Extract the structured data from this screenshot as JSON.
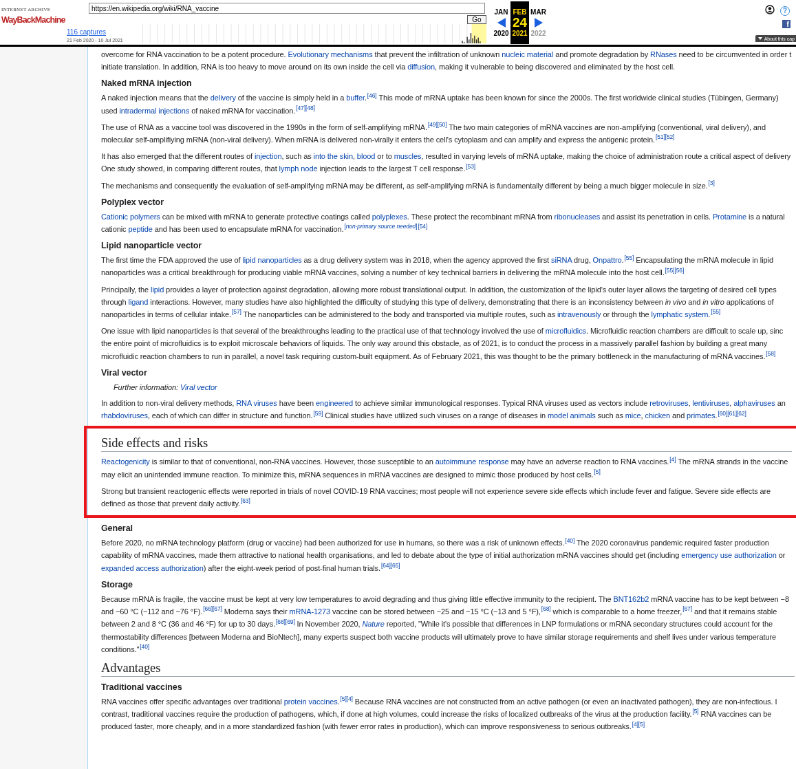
{
  "toolbar": {
    "logo_top": "INTERNET ARCHIVE",
    "logo": "WayBackMachine",
    "url": "https://en.wikipedia.org/wiki/RNA_vaccine",
    "go": "Go",
    "captures": "116 captures",
    "range": "21 Feb 2020 - 10 Jul 2021",
    "months": [
      {
        "label": "JAN",
        "selected": false
      },
      {
        "label": "FEB",
        "selected": true
      },
      {
        "label": "MAR",
        "selected": false
      }
    ],
    "day": "24",
    "years": [
      {
        "label": "2020",
        "selected": false,
        "disabled": false
      },
      {
        "label": "2021",
        "selected": true,
        "disabled": false
      },
      {
        "label": "2022",
        "selected": false,
        "disabled": true
      }
    ],
    "help": "?",
    "facebook": "f",
    "about": "About this cap"
  },
  "article": {
    "sections": [
      {
        "highlighted": false,
        "blocks": [
          {
            "kind": "p",
            "parts": [
              {
                "kind": "text",
                "text": "overcome for RNA vaccination to be a potent procedure. "
              },
              {
                "kind": "link",
                "text": "Evolutionary mechanisms"
              },
              {
                "kind": "text",
                "text": " that prevent the infiltration of unknown "
              },
              {
                "kind": "link",
                "text": "nucleic material"
              },
              {
                "kind": "text",
                "text": " and promote degradation by "
              },
              {
                "kind": "link",
                "text": "RNases"
              },
              {
                "kind": "text",
                "text": " need to be circumvented in order t initiate translation. In addition, RNA is too heavy to move around on its own inside the cell via "
              },
              {
                "kind": "link",
                "text": "diffusion"
              },
              {
                "kind": "text",
                "text": ", making it vulnerable to being discovered and eliminated by the host cell."
              }
            ]
          },
          {
            "kind": "h3",
            "text": "Naked mRNA injection"
          },
          {
            "kind": "p",
            "parts": [
              {
                "kind": "text",
                "text": "A naked injection means that the "
              },
              {
                "kind": "link",
                "text": "delivery"
              },
              {
                "kind": "text",
                "text": " of the vaccine is simply held in a "
              },
              {
                "kind": "link",
                "text": "buffer"
              },
              {
                "kind": "text",
                "text": "."
              },
              {
                "kind": "ref",
                "text": "[46]"
              },
              {
                "kind": "text",
                "text": " This mode of mRNA uptake has been known for since the 2000s. The first worldwide clinical studies (Tübingen, Germany) used "
              },
              {
                "kind": "link",
                "text": "intradermal injections"
              },
              {
                "kind": "text",
                "text": " of naked mRNA for vaccination."
              },
              {
                "kind": "ref",
                "text": "[47][48]"
              }
            ]
          },
          {
            "kind": "p",
            "parts": [
              {
                "kind": "text",
                "text": "The use of RNA as a vaccine tool was discovered in the 1990s in the form of self-amplifying mRNA."
              },
              {
                "kind": "ref",
                "text": "[49][50]"
              },
              {
                "kind": "text",
                "text": " The two main categories of mRNA vaccines are non-amplifying (conventional, viral delivery), and molecular self-amplifiying mRNA (non-viral delivery). When mRNA is delivered non-virally it enters the cell's cytoplasm and can amplify and express the antigenic protein."
              },
              {
                "kind": "ref",
                "text": "[51][52]"
              }
            ]
          },
          {
            "kind": "p",
            "parts": [
              {
                "kind": "text",
                "text": "It has also emerged that the different routes of "
              },
              {
                "kind": "link",
                "text": "injection"
              },
              {
                "kind": "text",
                "text": ", such as "
              },
              {
                "kind": "link",
                "text": "into the skin"
              },
              {
                "kind": "text",
                "text": ", "
              },
              {
                "kind": "link",
                "text": "blood"
              },
              {
                "kind": "text",
                "text": " or to "
              },
              {
                "kind": "link",
                "text": "muscles"
              },
              {
                "kind": "text",
                "text": ", resulted in varying levels of mRNA uptake, making the choice of administration route a critical aspect of delivery One study showed, in comparing different routes, that "
              },
              {
                "kind": "link",
                "text": "lymph node"
              },
              {
                "kind": "text",
                "text": " injection leads to the largest T cell response."
              },
              {
                "kind": "ref",
                "text": "[53]"
              }
            ]
          },
          {
            "kind": "p",
            "parts": [
              {
                "kind": "text",
                "text": "The mechanisms and consequently the evaluation of self-amplifying mRNA may be different, as self-amplifying mRNA is fundamentally different by being a much bigger molecule in size."
              },
              {
                "kind": "ref",
                "text": "[3]"
              }
            ]
          },
          {
            "kind": "h3",
            "text": "Polyplex vector"
          },
          {
            "kind": "p",
            "parts": [
              {
                "kind": "link",
                "text": "Cationic polymers"
              },
              {
                "kind": "text",
                "text": " can be mixed with mRNA to generate protective coatings called "
              },
              {
                "kind": "link",
                "text": "polyplexes"
              },
              {
                "kind": "text",
                "text": ". These protect the recombinant mRNA from "
              },
              {
                "kind": "link",
                "text": "ribonucleases"
              },
              {
                "kind": "text",
                "text": " and assist its penetration in cells. "
              },
              {
                "kind": "link",
                "text": "Protamine"
              },
              {
                "kind": "text",
                "text": " is a natural cationic "
              },
              {
                "kind": "link",
                "text": "peptide"
              },
              {
                "kind": "text",
                "text": " and has been used to encapsulate mRNA for vaccination."
              },
              {
                "kind": "ref",
                "text": "[*non-primary source needed*]"
              },
              {
                "kind": "ref",
                "text": "[54]"
              }
            ]
          },
          {
            "kind": "h3",
            "text": "Lipid nanoparticle vector"
          },
          {
            "kind": "p",
            "parts": [
              {
                "kind": "text",
                "text": "The first time the FDA approved the use of "
              },
              {
                "kind": "link",
                "text": "lipid nanoparticles"
              },
              {
                "kind": "text",
                "text": " as a drug delivery system was in 2018, when the agency approved the first "
              },
              {
                "kind": "link",
                "text": "siRNA"
              },
              {
                "kind": "text",
                "text": " drug, "
              },
              {
                "kind": "link",
                "text": "Onpattro"
              },
              {
                "kind": "text",
                "text": "."
              },
              {
                "kind": "ref",
                "text": "[55]"
              },
              {
                "kind": "text",
                "text": " Encapsulating the mRNA molecule in lipid nanoparticles was a critical breakthrough for producing viable mRNA vaccines, solving a number of key technical barriers in delivering the mRNA molecule into the host cell."
              },
              {
                "kind": "ref",
                "text": "[55][56]"
              }
            ]
          },
          {
            "kind": "p",
            "parts": [
              {
                "kind": "text",
                "text": "Principally, the "
              },
              {
                "kind": "link",
                "text": "lipid"
              },
              {
                "kind": "text",
                "text": " provides a layer of protection against degradation, allowing more robust translational output. In addition, the customization of the lipid's outer layer allows the targeting of desired cell types through "
              },
              {
                "kind": "link",
                "text": "ligand"
              },
              {
                "kind": "text",
                "text": " interactions. However, many studies have also highlighted the difficulty of studying this type of delivery, demonstrating that there is an inconsistency between *in vivo* and *in vitro* applications of nanoparticles in terms of cellular intake."
              },
              {
                "kind": "ref",
                "text": "[57]"
              },
              {
                "kind": "text",
                "text": " The nanoparticles can be administered to the body and transported via multiple routes, such as "
              },
              {
                "kind": "link",
                "text": "intravenously"
              },
              {
                "kind": "text",
                "text": " or through the "
              },
              {
                "kind": "link",
                "text": "lymphatic system"
              },
              {
                "kind": "text",
                "text": "."
              },
              {
                "kind": "ref",
                "text": "[55]"
              }
            ]
          },
          {
            "kind": "p",
            "parts": [
              {
                "kind": "text",
                "text": "One issue with lipid nanoparticles is that several of the breakthroughs leading to the practical use of that technology involved the use of "
              },
              {
                "kind": "link",
                "text": "microfluidics"
              },
              {
                "kind": "text",
                "text": ". Microfluidic reaction chambers are difficult to scale up, sinc the entire point of microfluidics is to exploit microscale behaviors of liquids. The only way around this obstacle, as of 2021, is to conduct the process in a massively parallel fashion by building a great many microfluidic reaction chambers to run in parallel, a novel task requiring custom-built equipment. As of February 2021, this was thought to be the primary bottleneck in the manufacturing of mRNA vaccines."
              },
              {
                "kind": "ref",
                "text": "[58]"
              }
            ]
          },
          {
            "kind": "h3",
            "text": "Viral vector"
          },
          {
            "kind": "note",
            "parts": [
              {
                "kind": "text",
                "text": "Further information: "
              },
              {
                "kind": "link",
                "text": "Viral vector"
              }
            ]
          },
          {
            "kind": "p",
            "parts": [
              {
                "kind": "text",
                "text": "In addition to non-viral delivery methods, "
              },
              {
                "kind": "link",
                "text": "RNA viruses"
              },
              {
                "kind": "text",
                "text": " have been "
              },
              {
                "kind": "link",
                "text": "engineered"
              },
              {
                "kind": "text",
                "text": " to achieve similar immunological responses. Typical RNA viruses used as vectors include "
              },
              {
                "kind": "link",
                "text": "retroviruses"
              },
              {
                "kind": "text",
                "text": ", "
              },
              {
                "kind": "link",
                "text": "lentiviruses"
              },
              {
                "kind": "text",
                "text": ", "
              },
              {
                "kind": "link",
                "text": "alphaviruses"
              },
              {
                "kind": "text",
                "text": " an "
              },
              {
                "kind": "link",
                "text": "rhabdoviruses"
              },
              {
                "kind": "text",
                "text": ", each of which can differ in structure and function."
              },
              {
                "kind": "ref",
                "text": "[59]"
              },
              {
                "kind": "text",
                "text": " Clinical studies have utilized such viruses on a range of diseases in "
              },
              {
                "kind": "link",
                "text": "model animals"
              },
              {
                "kind": "text",
                "text": " such as "
              },
              {
                "kind": "link",
                "text": "mice"
              },
              {
                "kind": "text",
                "text": ", "
              },
              {
                "kind": "link",
                "text": "chicken"
              },
              {
                "kind": "text",
                "text": " and "
              },
              {
                "kind": "link",
                "text": "primates"
              },
              {
                "kind": "text",
                "text": "."
              },
              {
                "kind": "ref",
                "text": "[60][61][62]"
              }
            ]
          }
        ]
      },
      {
        "highlighted": true,
        "blocks": [
          {
            "kind": "h2",
            "text": "Side effects and risks"
          },
          {
            "kind": "p",
            "parts": [
              {
                "kind": "link",
                "text": "Reactogenicity"
              },
              {
                "kind": "text",
                "text": " is similar to that of conventional, non-RNA vaccines. However, those susceptible to an "
              },
              {
                "kind": "link",
                "text": "autoimmune response"
              },
              {
                "kind": "text",
                "text": " may have an adverse reaction to RNA vaccines."
              },
              {
                "kind": "ref",
                "text": "[4]"
              },
              {
                "kind": "text",
                "text": " The mRNA strands in the vaccine may elicit an unintended immune reaction. To minimize this, mRNA sequences in mRNA vaccines are designed to mimic those produced by host cells."
              },
              {
                "kind": "ref",
                "text": "[5]"
              }
            ]
          },
          {
            "kind": "p",
            "parts": [
              {
                "kind": "text",
                "text": "Strong but transient reactogenic effects were reported in trials of novel COVID-19 RNA vaccines; most people will not experience severe side effects which include fever and fatigue. Severe side effects are defined as those that prevent daily activity."
              },
              {
                "kind": "ref",
                "text": "[63]"
              }
            ]
          }
        ]
      },
      {
        "highlighted": false,
        "blocks": [
          {
            "kind": "h3",
            "text": "General"
          },
          {
            "kind": "p",
            "parts": [
              {
                "kind": "text",
                "text": "Before 2020, no mRNA technology platform (drug or vaccine) had been authorized for use in humans, so there was a risk of unknown effects."
              },
              {
                "kind": "ref",
                "text": "[40]"
              },
              {
                "kind": "text",
                "text": " The 2020 coronavirus pandemic required faster production capability of mRNA vaccines, made them attractive to national health organisations, and led to debate about the type of initial authorization mRNA vaccines should get (including "
              },
              {
                "kind": "link",
                "text": "emergency use authorization"
              },
              {
                "kind": "text",
                "text": " or "
              },
              {
                "kind": "link",
                "text": "expanded access authorization"
              },
              {
                "kind": "text",
                "text": ") after the eight-week period of post-final human trials."
              },
              {
                "kind": "ref",
                "text": "[64][65]"
              }
            ]
          },
          {
            "kind": "h3",
            "text": "Storage"
          },
          {
            "kind": "p",
            "parts": [
              {
                "kind": "text",
                "text": "Because mRNA is fragile, the vaccine must be kept at very low temperatures to avoid degrading and thus giving little effective immunity to the recipient. The "
              },
              {
                "kind": "link",
                "text": "BNT162b2"
              },
              {
                "kind": "text",
                "text": " mRNA vaccine has to be kept between −8 and −60 °C (−112 and −76 °F)."
              },
              {
                "kind": "ref",
                "text": "[66][67]"
              },
              {
                "kind": "text",
                "text": " Moderna says their "
              },
              {
                "kind": "link",
                "text": "mRNA-1273"
              },
              {
                "kind": "text",
                "text": " vaccine can be stored between −25 and −15 °C (−13 and 5 °F),"
              },
              {
                "kind": "ref",
                "text": "[68]"
              },
              {
                "kind": "text",
                "text": " which is comparable to a home freezer,"
              },
              {
                "kind": "ref",
                "text": "[67]"
              },
              {
                "kind": "text",
                "text": " and that it remains stable between 2 and 8 °C (36 and 46 °F) for up to 30 days."
              },
              {
                "kind": "ref",
                "text": "[68][69]"
              },
              {
                "kind": "text",
                "text": " In November 2020, "
              },
              {
                "kind": "link",
                "text": "*Nature*"
              },
              {
                "kind": "text",
                "text": " reported, \"While it's possible that differences in LNP formulations or mRNA secondary structures could account for the thermostability differences [between Moderna and BioNtech], many experts suspect both vaccine products will ultimately prove to have similar storage requirements and shelf lives under various temperature conditions.\""
              },
              {
                "kind": "ref",
                "text": "[40]"
              }
            ]
          },
          {
            "kind": "h2",
            "text": "Advantages"
          },
          {
            "kind": "h3",
            "text": "Traditional vaccines"
          },
          {
            "kind": "p",
            "parts": [
              {
                "kind": "text",
                "text": "RNA vaccines offer specific advantages over traditional "
              },
              {
                "kind": "link",
                "text": "protein vaccines"
              },
              {
                "kind": "text",
                "text": "."
              },
              {
                "kind": "ref",
                "text": "[5][4]"
              },
              {
                "kind": "text",
                "text": " Because RNA vaccines are not constructed from an active pathogen (or even an inactivated pathogen), they are non-infectious. I contrast, traditional vaccines require the production of pathogens, which, if done at high volumes, could increase the risks of localized outbreaks of the virus at the production facility."
              },
              {
                "kind": "ref",
                "text": "[5]"
              },
              {
                "kind": "text",
                "text": " RNA vaccines can be produced faster, more cheaply, and in a more standardized fashion (with fewer error rates in production), which can improve responsiveness to serious outbreaks."
              },
              {
                "kind": "ref",
                "text": "[4][5]"
              }
            ]
          }
        ]
      }
    ]
  }
}
